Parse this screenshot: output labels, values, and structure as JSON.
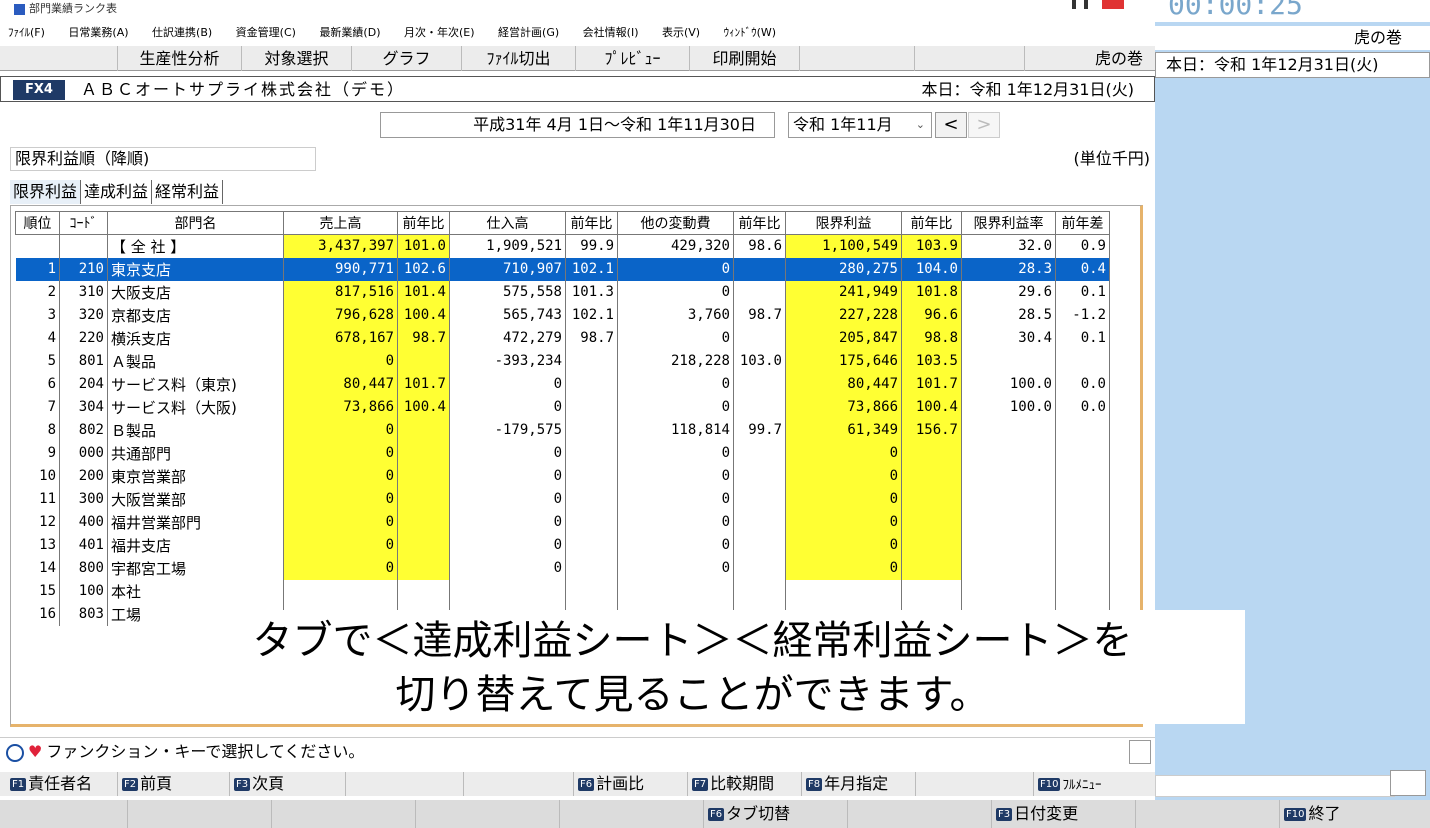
{
  "window": {
    "title": "部門業績ランク表"
  },
  "timer": {
    "time": "00:00:25"
  },
  "menu": [
    "ﾌｧｲﾙ(F)",
    "日常業務(A)",
    "仕訳連携(B)",
    "資金管理(C)",
    "最新業績(D)",
    "月次・年次(E)",
    "経営計画(G)",
    "会社情報(I)",
    "表示(V)",
    "ｳｨﾝﾄﾞｳ(W)"
  ],
  "toolbar": [
    "生産性分析",
    "対象選択",
    "グラフ",
    "ﾌｧｲﾙ切出",
    "ﾌﾟﾚﾋﾞｭｰ",
    "印刷開始",
    "虎の巻"
  ],
  "right_panel": {
    "tiger": "虎の巻",
    "today": "本日：令和 1年12月31日(火)"
  },
  "company": {
    "badge": "FX4",
    "name": "ＡＢＣオートサプライ株式会社（デモ）",
    "today": "本日：令和 1年12月31日(火)"
  },
  "period": {
    "range": "平成31年 4月 1日～令和 1年11月30日",
    "month": "令和 1年11月",
    "prev": "<",
    "next": ">"
  },
  "sort": {
    "label": "限界利益順（降順)",
    "unit": "(単位千円)"
  },
  "tabs": [
    {
      "label": "限界利益",
      "active": true
    },
    {
      "label": "達成利益",
      "active": false
    },
    {
      "label": "経常利益",
      "active": false
    }
  ],
  "table": {
    "headers": [
      "順位",
      "ｺｰﾄﾞ",
      "部門名",
      "売上高",
      "前年比",
      "仕入高",
      "前年比",
      "他の変動費",
      "前年比",
      "限界利益",
      "前年比",
      "限界利益率",
      "前年差"
    ],
    "total": [
      "",
      "",
      "【 全 社 】",
      "3,437,397",
      "101.0",
      "1,909,521",
      "99.9",
      "429,320",
      "98.6",
      "1,100,549",
      "103.9",
      "32.0",
      "0.9"
    ],
    "rows": [
      [
        "1",
        "210",
        "東京支店",
        "990,771",
        "102.6",
        "710,907",
        "102.1",
        "0",
        "",
        "280,275",
        "104.0",
        "28.3",
        "0.4"
      ],
      [
        "2",
        "310",
        "大阪支店",
        "817,516",
        "101.4",
        "575,558",
        "101.3",
        "0",
        "",
        "241,949",
        "101.8",
        "29.6",
        "0.1"
      ],
      [
        "3",
        "320",
        "京都支店",
        "796,628",
        "100.4",
        "565,743",
        "102.1",
        "3,760",
        "98.7",
        "227,228",
        "96.6",
        "28.5",
        "-1.2"
      ],
      [
        "4",
        "220",
        "横浜支店",
        "678,167",
        "98.7",
        "472,279",
        "98.7",
        "0",
        "",
        "205,847",
        "98.8",
        "30.4",
        "0.1"
      ],
      [
        "5",
        "801",
        "Ａ製品",
        "0",
        "",
        "-393,234",
        "",
        "218,228",
        "103.0",
        "175,646",
        "103.5",
        "",
        ""
      ],
      [
        "6",
        "204",
        "サービス料（東京)",
        "80,447",
        "101.7",
        "0",
        "",
        "0",
        "",
        "80,447",
        "101.7",
        "100.0",
        "0.0"
      ],
      [
        "7",
        "304",
        "サービス料（大阪)",
        "73,866",
        "100.4",
        "0",
        "",
        "0",
        "",
        "73,866",
        "100.4",
        "100.0",
        "0.0"
      ],
      [
        "8",
        "802",
        "Ｂ製品",
        "0",
        "",
        "-179,575",
        "",
        "118,814",
        "99.7",
        "61,349",
        "156.7",
        "",
        ""
      ],
      [
        "9",
        "000",
        "共通部門",
        "0",
        "",
        "0",
        "",
        "0",
        "",
        "0",
        "",
        "",
        ""
      ],
      [
        "10",
        "200",
        "東京営業部",
        "0",
        "",
        "0",
        "",
        "0",
        "",
        "0",
        "",
        "",
        ""
      ],
      [
        "11",
        "300",
        "大阪営業部",
        "0",
        "",
        "0",
        "",
        "0",
        "",
        "0",
        "",
        "",
        ""
      ],
      [
        "12",
        "400",
        "福井営業部門",
        "0",
        "",
        "0",
        "",
        "0",
        "",
        "0",
        "",
        "",
        ""
      ],
      [
        "13",
        "401",
        "福井支店",
        "0",
        "",
        "0",
        "",
        "0",
        "",
        "0",
        "",
        "",
        ""
      ],
      [
        "14",
        "800",
        "宇都宮工場",
        "0",
        "",
        "0",
        "",
        "0",
        "",
        "0",
        "",
        "",
        ""
      ],
      [
        "15",
        "100",
        "本社",
        "",
        "",
        "",
        "",
        "",
        "",
        "",
        "",
        "",
        ""
      ],
      [
        "16",
        "803",
        "工場",
        "",
        "",
        "",
        "",
        "",
        "",
        "",
        "",
        "",
        ""
      ]
    ]
  },
  "caption": {
    "line1": "タブで＜達成利益シート＞＜経常利益シート＞を",
    "line2": "切り替えて見ることができます。"
  },
  "status": {
    "text": "ファンクション・キーで選択してください。"
  },
  "fkeys_row1": [
    {
      "key": "F1",
      "label": "責任者名"
    },
    {
      "key": "F2",
      "label": "前頁"
    },
    {
      "key": "F3",
      "label": "次頁"
    },
    {
      "key": "F6",
      "label": "計画比"
    },
    {
      "key": "F7",
      "label": "比較期間"
    },
    {
      "key": "F8",
      "label": "年月指定"
    },
    {
      "key": "F10",
      "label": "ﾌﾙﾒﾆｭｰ"
    }
  ],
  "fkeys_row2": [
    {
      "key": "F6",
      "label": "タブ切替"
    },
    {
      "key": "F3",
      "label": "日付変更"
    },
    {
      "key": "F10",
      "label": "終了"
    }
  ],
  "colors": {
    "highlight": "#ffff33",
    "selected": "#0a64c8",
    "badge": "#1f3a66"
  }
}
